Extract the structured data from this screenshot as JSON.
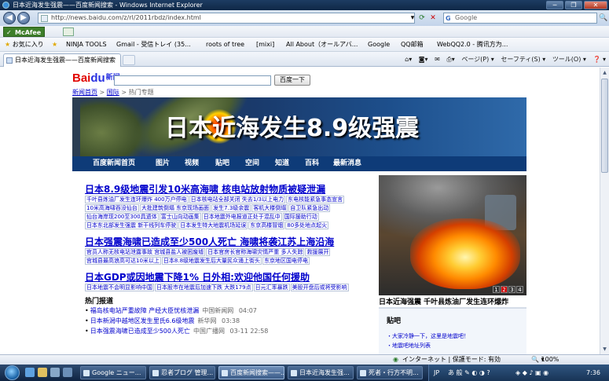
{
  "window": {
    "title": "日本近海发生强震——百度新闻搜索 - Windows Internet Explorer",
    "min": "─",
    "max": "❐",
    "close": "✕"
  },
  "address": {
    "url": "http://news.baidu.com/z/rl/2011rbdz/index.html",
    "search_placeholder": "Google",
    "search_engine": "G"
  },
  "toolbar": {
    "mcafee": "McAfee"
  },
  "favorites": {
    "label": "お気に入り",
    "items": [
      "NINJA TOOLS",
      "Gmail - 受信トレイ (35...",
      "roots of tree",
      "[mixi]",
      "All About（オールアバ...",
      "Google",
      "QQ邮箱",
      "WebQQ2.0 - 腾讯方为..."
    ]
  },
  "tabs": [
    {
      "label": "日本近海发生强震——百度新闻搜索"
    }
  ],
  "commandbar": {
    "page": "ページ(P) ▾",
    "safety": "セーフティ(S) ▾",
    "tools": "ツール(O) ▾",
    "help": "❓ ▾"
  },
  "page": {
    "logo": {
      "bai": "Bai",
      "du": "du",
      "news": "新闻"
    },
    "search_button": "百度一下",
    "breadcrumb": [
      "新闻首页",
      "国际",
      "热门专题"
    ],
    "breadcrumb_sep": ">",
    "banner_title": "日本近海发生8.9级强震",
    "banner_nav": [
      "百度新闻首页",
      "图片",
      "视频",
      "贴吧",
      "空间",
      "知道",
      "百科",
      "最新消息"
    ],
    "headlines": [
      {
        "title": "日本8.9级地震引发10米高海啸  核电站放射物质被疑泄漏",
        "subs": [
          [
            "千叶县炼油厂发生连环爆炸 400万户停电",
            "日本核电站全部关闭 失去1/3以上电力",
            "东电核能紧急事态宣言"
          ],
          [
            "10米高海啸吞没仙台",
            "大批建筑倒塌 东京现场画面",
            "发生7.3级余震",
            "客机大楼倒塌",
            "自卫队紧急出动"
          ],
          [
            "仙台海岸现200至300具遗体",
            "富士山向动画集",
            "日本地震外电报道正处于混乱中",
            "国际援助行动"
          ],
          [
            "日本东北部发生强震 新干线列车停驶",
            "日本发生特大地震机场延误",
            "东京高楼冒烟",
            "80多处地点起火"
          ]
        ]
      },
      {
        "title": "日本强震海啸已造成至少500人死亡  海啸将袭江苏上海沿海",
        "subs": [
          [
            "官员人称无核电站泄露事故 宫城县盐人被困废墟",
            "日本官房长官称海啸灾情严重 多人失踪",
            "救援展开"
          ],
          [
            "宫城县最高浪高可达10米以上",
            "日本8.8级地震发生后大量民众涌上街头",
            "东京地区国电停电"
          ]
        ]
      },
      {
        "title": "日本GDP或因地震下降1%  日外相:欢迎他国任何援助",
        "subs": [
          [
            "日本地震不会明显影响中国",
            "日本股市在地震后加速下跌 大跌179点",
            "日元汇率暴跌",
            "美股开盘后或将受影响"
          ]
        ]
      }
    ],
    "hot_section": "热门报道",
    "hot_items": [
      {
        "title": "福岛核电站严重故障 产经大臣忧核泄漏",
        "src": "中国新闻网",
        "time": "04:07"
      },
      {
        "title": "日本新潟中越地区发生里氏6.6级地震",
        "src": "新华网",
        "time": "03:38"
      },
      {
        "title": "日本强震海啸已造成至少500人死亡",
        "src": "中国广播网",
        "time": "03-11 22:58"
      }
    ],
    "photo_caption": "日本近海强震  千叶县炼油厂发生连环爆炸",
    "photo_pager": [
      "1",
      "2",
      "3",
      "4"
    ],
    "tieba_title": "贴吧",
    "tieba_items": [
      "・大家冷静一下，这里是地震吧！",
      "・地震吧地址列表"
    ]
  },
  "status": {
    "zone": "インターネット | 保護モード: 有効",
    "zoom": "100%"
  },
  "taskbar": {
    "tasks": [
      "Google ニュー...",
      "忍者ブログ 管理...",
      "百度新闻搜索——...",
      "日本近海发生强...",
      "死者・行方不明..."
    ],
    "lang": "JP",
    "time": "7:36"
  }
}
